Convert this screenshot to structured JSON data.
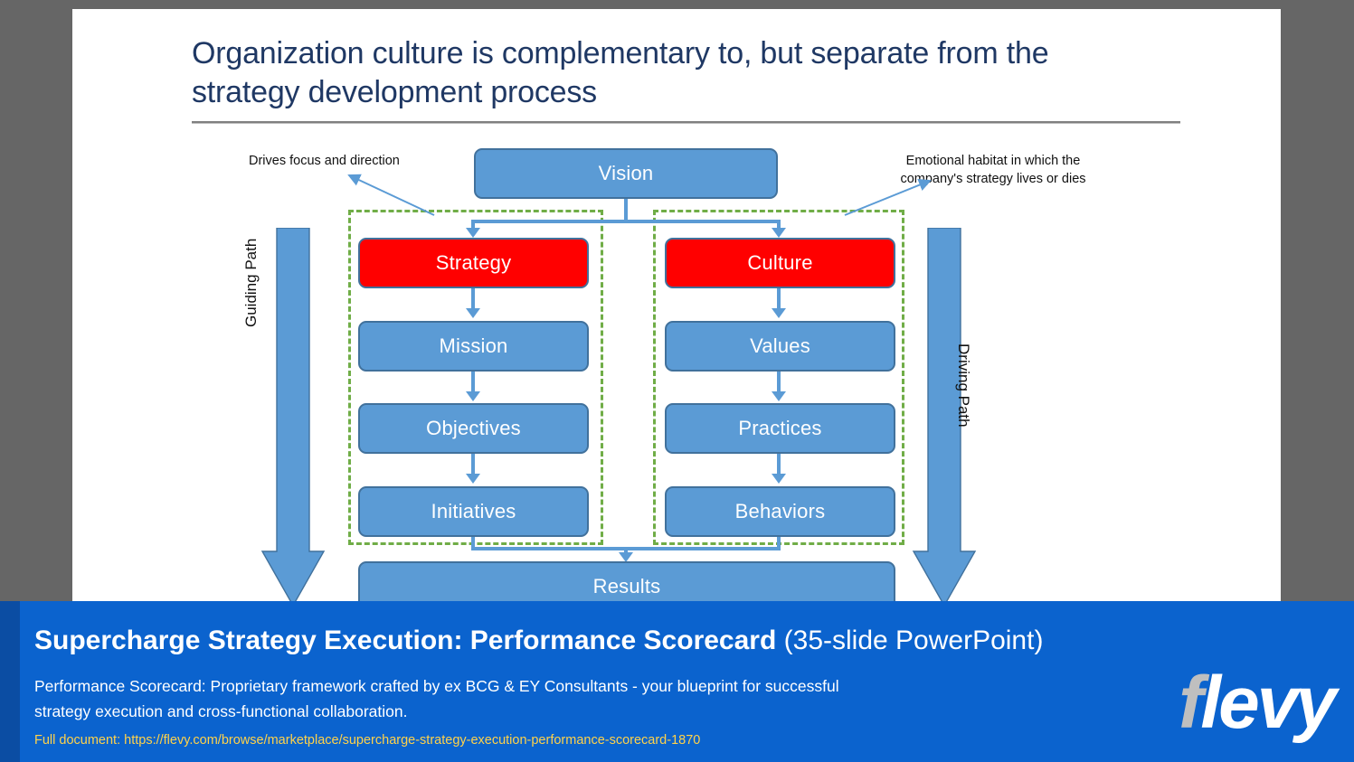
{
  "slide": {
    "title": "Organization culture is complementary to, but separate from the\nstrategy development process",
    "annotations": {
      "left": "Drives focus and direction",
      "right": "Emotional habitat in which the\ncompany's strategy lives or dies"
    },
    "path_labels": {
      "left": "Guiding Path",
      "right": "Driving Path"
    },
    "nodes": {
      "vision": "Vision",
      "strategy": "Strategy",
      "mission": "Mission",
      "objectives": "Objectives",
      "initiatives": "Initiatives",
      "culture": "Culture",
      "values": "Values",
      "practices": "Practices",
      "behaviors": "Behaviors",
      "results": "Results"
    },
    "colors": {
      "title_text": "#1F3864",
      "node_blue": "#5B9BD5",
      "node_border": "#41719C",
      "node_red": "#FF0000",
      "zone_green": "#70AD47",
      "canvas": "#FFFFFF",
      "backdrop": "#666666"
    }
  },
  "footer": {
    "title_bold": "Supercharge Strategy Execution: Performance Scorecard",
    "title_light": "(35-slide PowerPoint)",
    "subtitle": "Performance Scorecard: Proprietary framework crafted by ex BCG & EY Consultants - your blueprint for successful\nstrategy execution and cross-functional collaboration.",
    "url_line": "Full document: https://flevy.com/browse/marketplace/supercharge-strategy-execution-performance-scorecard-1870",
    "logo": {
      "f": "f",
      "rest": "levy"
    },
    "colors": {
      "background": "#0B63CE",
      "edge": "#0B4DA3",
      "url": "#FFD24A",
      "logo_f": "#BFBFBF"
    }
  }
}
